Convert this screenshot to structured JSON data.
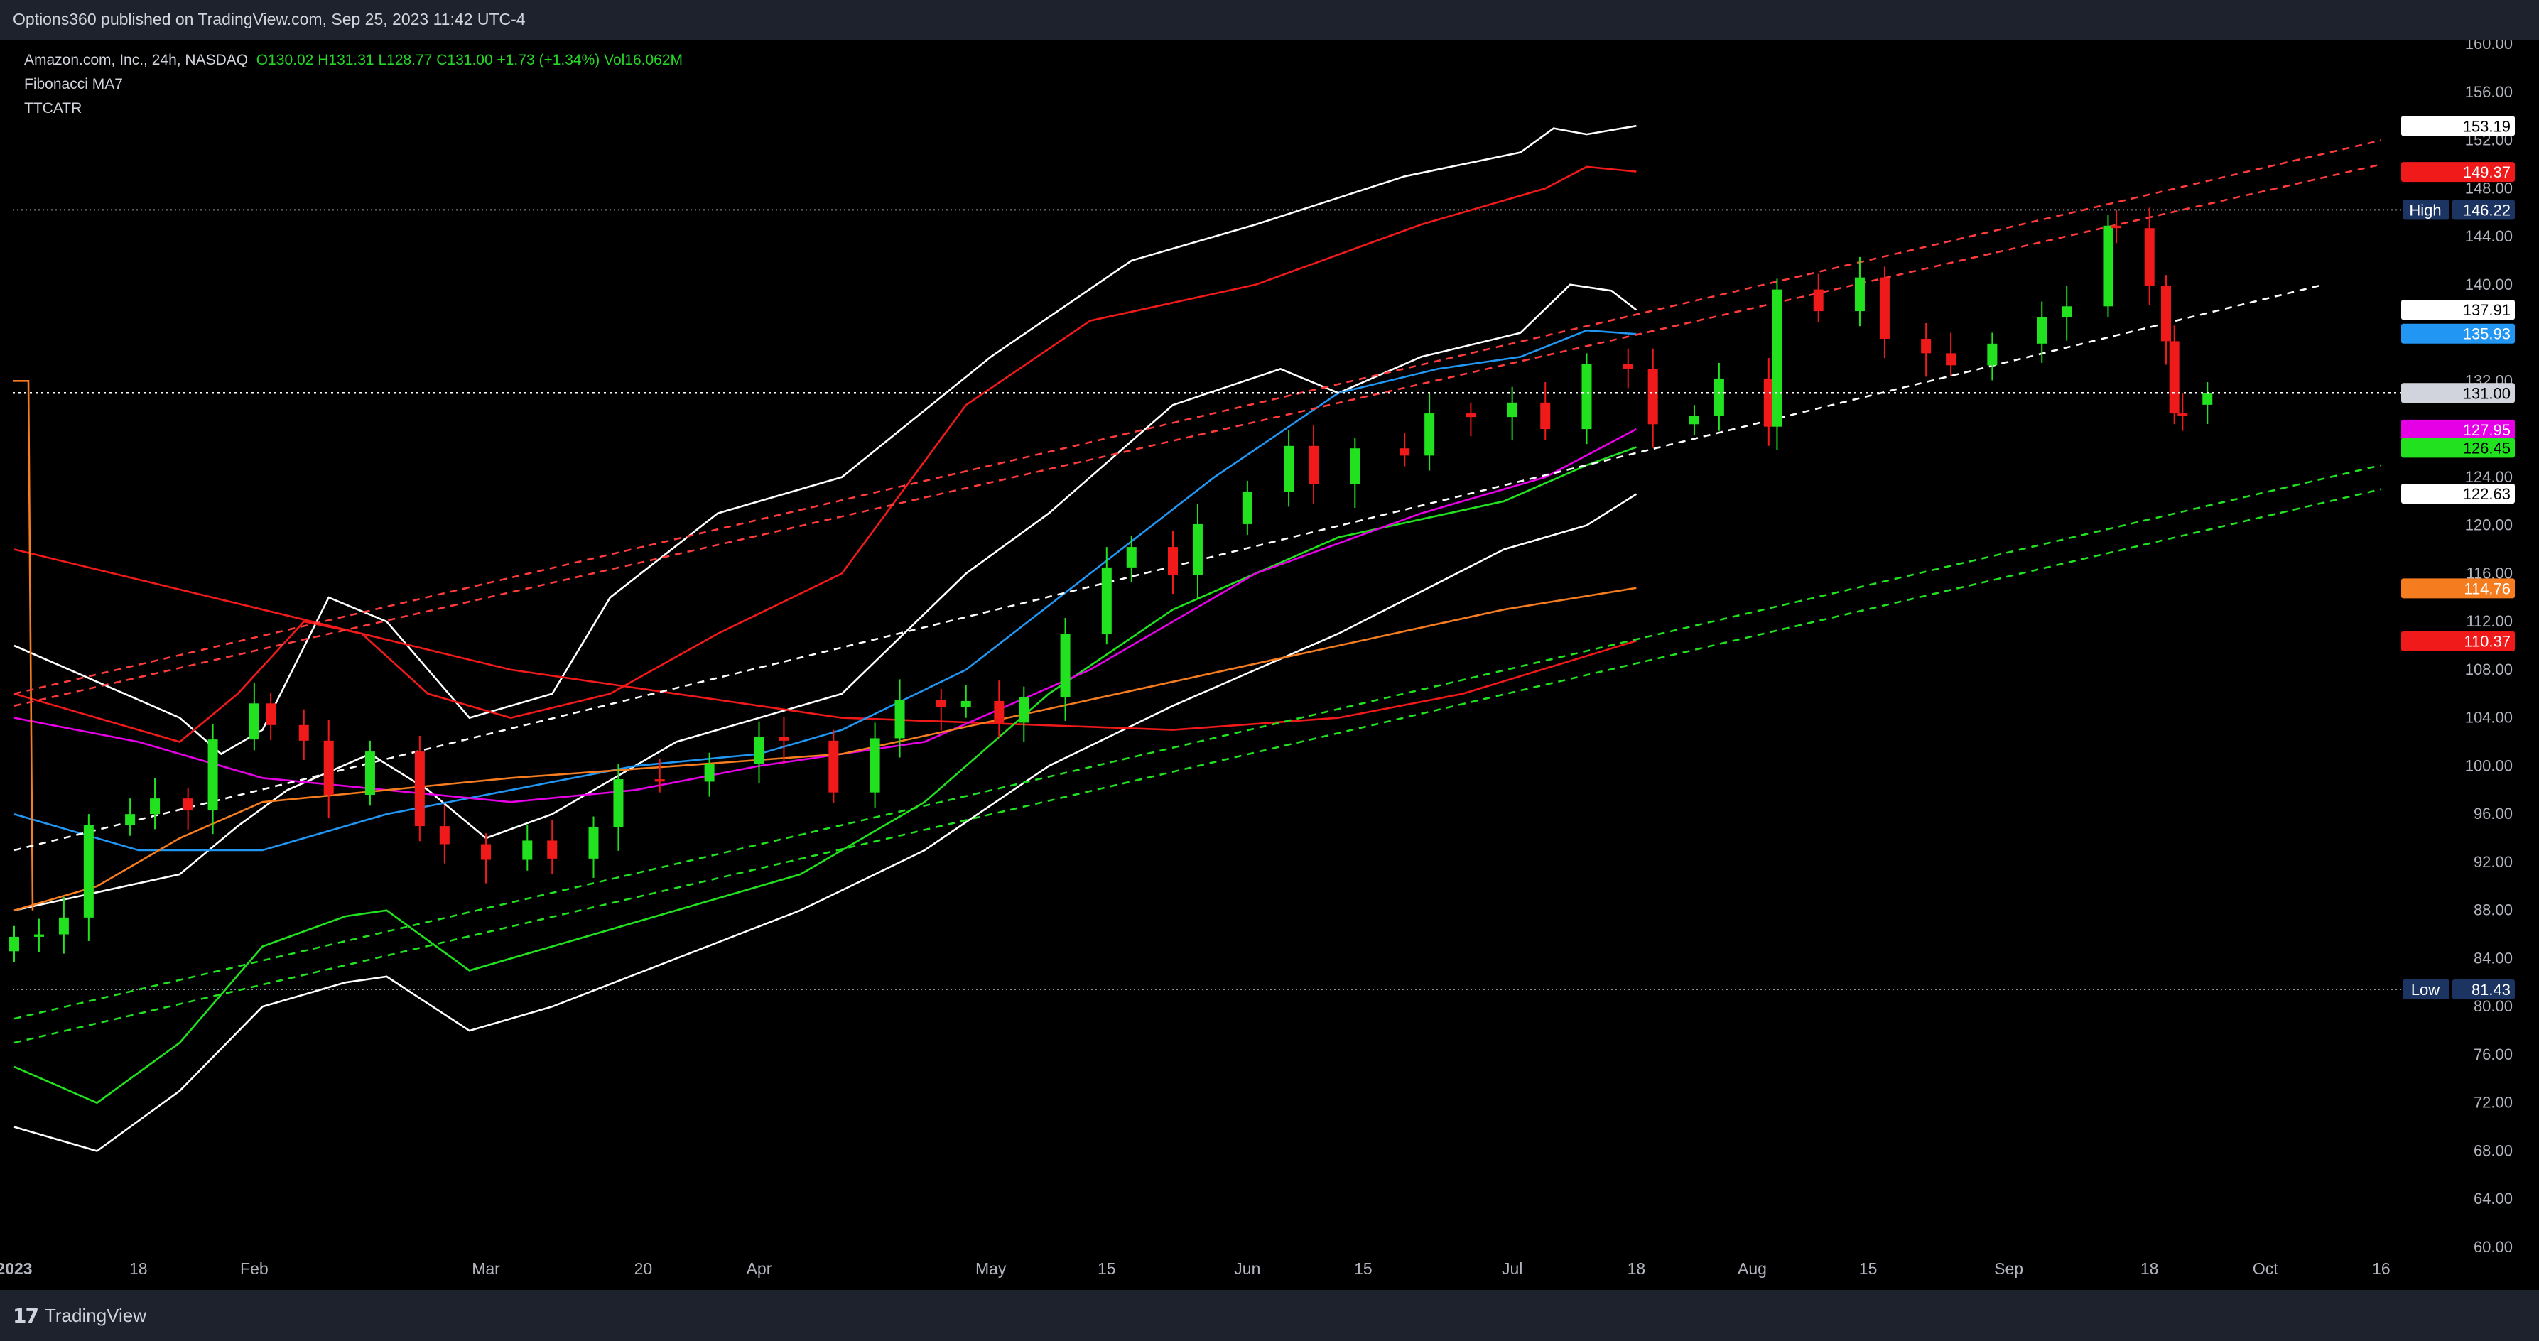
{
  "header": {
    "published": "Options360 published on TradingView.com, Sep 25, 2023 11:42 UTC-4"
  },
  "legend": {
    "symbol": "Amazon.com, Inc., 24h, NASDAQ",
    "open": "O130.02",
    "high": "H131.31",
    "low": "L128.77",
    "close": "C131.00",
    "change": "+1.73 (+1.34%)",
    "volume": "Vol16.062M",
    "indicator1": "Fibonacci MA7",
    "indicator2": "TTCATR"
  },
  "footer": {
    "brand": "TradingView"
  },
  "colors": {
    "up": "#22e11f",
    "down": "#f01a1a",
    "background": "#000000",
    "panel": "#1e222d"
  },
  "chart_data": {
    "type": "candlestick",
    "symbol": "AMZN",
    "ylim": [
      60,
      160
    ],
    "y_ticks": [
      "160.00",
      "156.00",
      "152.00",
      "148.00",
      "144.00",
      "140.00",
      "136.00",
      "132.00",
      "128.00",
      "124.00",
      "120.00",
      "116.00",
      "112.00",
      "108.00",
      "104.00",
      "100.00",
      "96.00",
      "92.00",
      "88.00",
      "84.00",
      "80.00",
      "76.00",
      "72.00",
      "68.00",
      "64.00",
      "60.00"
    ],
    "x_ticks": [
      {
        "label": "2023",
        "date": "2023-01-03"
      },
      {
        "label": "18",
        "date": "2023-01-18"
      },
      {
        "label": "Feb",
        "date": "2023-02-01"
      },
      {
        "label": "Mar",
        "date": "2023-03-01"
      },
      {
        "label": "20",
        "date": "2023-03-20"
      },
      {
        "label": "Apr",
        "date": "2023-04-03"
      },
      {
        "label": "May",
        "date": "2023-05-01"
      },
      {
        "label": "15",
        "date": "2023-05-15"
      },
      {
        "label": "Jun",
        "date": "2023-06-01"
      },
      {
        "label": "15",
        "date": "2023-06-15"
      },
      {
        "label": "Jul",
        "date": "2023-07-03"
      },
      {
        "label": "18",
        "date": "2023-07-18"
      },
      {
        "label": "Aug",
        "date": "2023-08-01"
      },
      {
        "label": "15",
        "date": "2023-08-15"
      },
      {
        "label": "Sep",
        "date": "2023-09-01"
      },
      {
        "label": "18",
        "date": "2023-09-18"
      },
      {
        "label": "Oct",
        "date": "2023-10-02"
      },
      {
        "label": "16",
        "date": "2023-10-16"
      }
    ],
    "closes": [
      {
        "date": "2023-01-03",
        "close": 85.8
      },
      {
        "date": "2023-01-06",
        "close": 86.0
      },
      {
        "date": "2023-01-09",
        "close": 87.4
      },
      {
        "date": "2023-01-12",
        "close": 95.1
      },
      {
        "date": "2023-01-17",
        "close": 96.0
      },
      {
        "date": "2023-01-20",
        "close": 97.3
      },
      {
        "date": "2023-01-24",
        "close": 96.3
      },
      {
        "date": "2023-01-27",
        "close": 102.2
      },
      {
        "date": "2023-02-01",
        "close": 105.2
      },
      {
        "date": "2023-02-03",
        "close": 103.4
      },
      {
        "date": "2023-02-07",
        "close": 102.1
      },
      {
        "date": "2023-02-10",
        "close": 97.6
      },
      {
        "date": "2023-02-15",
        "close": 101.2
      },
      {
        "date": "2023-02-21",
        "close": 95.0
      },
      {
        "date": "2023-02-24",
        "close": 93.5
      },
      {
        "date": "2023-03-01",
        "close": 92.2
      },
      {
        "date": "2023-03-06",
        "close": 93.8
      },
      {
        "date": "2023-03-09",
        "close": 92.3
      },
      {
        "date": "2023-03-14",
        "close": 94.9
      },
      {
        "date": "2023-03-17",
        "close": 98.9
      },
      {
        "date": "2023-03-22",
        "close": 98.7
      },
      {
        "date": "2023-03-28",
        "close": 100.2
      },
      {
        "date": "2023-04-03",
        "close": 102.4
      },
      {
        "date": "2023-04-06",
        "close": 102.1
      },
      {
        "date": "2023-04-12",
        "close": 97.8
      },
      {
        "date": "2023-04-17",
        "close": 102.3
      },
      {
        "date": "2023-04-20",
        "close": 105.5
      },
      {
        "date": "2023-04-25",
        "close": 104.9
      },
      {
        "date": "2023-04-28",
        "close": 105.4
      },
      {
        "date": "2023-05-02",
        "close": 103.6
      },
      {
        "date": "2023-05-05",
        "close": 105.7
      },
      {
        "date": "2023-05-10",
        "close": 111.0
      },
      {
        "date": "2023-05-15",
        "close": 116.5
      },
      {
        "date": "2023-05-18",
        "close": 118.2
      },
      {
        "date": "2023-05-23",
        "close": 115.9
      },
      {
        "date": "2023-05-26",
        "close": 120.1
      },
      {
        "date": "2023-06-01",
        "close": 122.8
      },
      {
        "date": "2023-06-06",
        "close": 126.6
      },
      {
        "date": "2023-06-09",
        "close": 123.4
      },
      {
        "date": "2023-06-14",
        "close": 126.4
      },
      {
        "date": "2023-06-20",
        "close": 125.8
      },
      {
        "date": "2023-06-23",
        "close": 129.3
      },
      {
        "date": "2023-06-28",
        "close": 129.0
      },
      {
        "date": "2023-07-03",
        "close": 130.2
      },
      {
        "date": "2023-07-07",
        "close": 128.0
      },
      {
        "date": "2023-07-12",
        "close": 133.4
      },
      {
        "date": "2023-07-17",
        "close": 133.0
      },
      {
        "date": "2023-07-20",
        "close": 128.4
      },
      {
        "date": "2023-07-25",
        "close": 129.1
      },
      {
        "date": "2023-07-28",
        "close": 132.2
      },
      {
        "date": "2023-08-03",
        "close": 128.2
      },
      {
        "date": "2023-08-04",
        "close": 139.6
      },
      {
        "date": "2023-08-09",
        "close": 137.8
      },
      {
        "date": "2023-08-14",
        "close": 140.6
      },
      {
        "date": "2023-08-17",
        "close": 135.5
      },
      {
        "date": "2023-08-22",
        "close": 134.3
      },
      {
        "date": "2023-08-25",
        "close": 133.3
      },
      {
        "date": "2023-08-30",
        "close": 135.1
      },
      {
        "date": "2023-09-05",
        "close": 137.3
      },
      {
        "date": "2023-09-08",
        "close": 138.2
      },
      {
        "date": "2023-09-13",
        "close": 144.9
      },
      {
        "date": "2023-09-14",
        "close": 144.7
      },
      {
        "date": "2023-09-18",
        "close": 139.9
      },
      {
        "date": "2023-09-20",
        "close": 135.3
      },
      {
        "date": "2023-09-21",
        "close": 129.3
      },
      {
        "date": "2023-09-22",
        "close": 129.1
      },
      {
        "date": "2023-09-25",
        "close": 131.0
      }
    ],
    "last_bar": {
      "open": 130.02,
      "high": 131.31,
      "low": 128.77,
      "close": 131.0
    },
    "high": {
      "label": "High",
      "value": 146.22
    },
    "low": {
      "label": "Low",
      "value": 81.43
    },
    "price_labels": [
      {
        "value": 153.19,
        "text": "153.19",
        "color": "#ffffff"
      },
      {
        "value": 149.37,
        "text": "149.37",
        "color": "#f01a1a"
      },
      {
        "value": 137.91,
        "text": "137.91",
        "color": "#ffffff"
      },
      {
        "value": 135.93,
        "text": "135.93",
        "color": "#2196f3"
      },
      {
        "value": 131.0,
        "text": "131.00",
        "color": "#d1d4dc"
      },
      {
        "value": 127.95,
        "text": "127.95",
        "color": "#e600e6"
      },
      {
        "value": 126.45,
        "text": "126.45",
        "color": "#22e11f"
      },
      {
        "value": 122.63,
        "text": "122.63",
        "color": "#ffffff"
      },
      {
        "value": 114.76,
        "text": "114.76",
        "color": "#f57c1f"
      },
      {
        "value": 110.37,
        "text": "110.37",
        "color": "#f01a1a"
      }
    ],
    "trendlines": [
      {
        "color": "#ffffff",
        "start": {
          "date": "2023-01-03",
          "price": 93
        },
        "end": {
          "date": "2023-10-09",
          "price": 140
        }
      },
      {
        "color": "#ff3b3b",
        "start": {
          "date": "2023-01-03",
          "price": 106
        },
        "end": {
          "date": "2023-10-16",
          "price": 152
        }
      },
      {
        "color": "#ff3b3b",
        "start": {
          "date": "2023-01-03",
          "price": 105
        },
        "end": {
          "date": "2023-10-16",
          "price": 150
        }
      },
      {
        "color": "#22e11f",
        "start": {
          "date": "2023-01-03",
          "price": 79
        },
        "end": {
          "date": "2023-10-16",
          "price": 125
        }
      },
      {
        "color": "#22e11f",
        "start": {
          "date": "2023-01-03",
          "price": 77
        },
        "end": {
          "date": "2023-10-16",
          "price": 123
        }
      }
    ],
    "indicators": [
      {
        "color": "#ffffff",
        "points": [
          [
            0,
            110
          ],
          [
            20,
            104
          ],
          [
            25,
            101
          ],
          [
            30,
            103
          ],
          [
            38,
            114
          ],
          [
            45,
            112
          ],
          [
            55,
            104
          ],
          [
            65,
            106
          ],
          [
            72,
            114
          ],
          [
            85,
            121
          ],
          [
            100,
            124
          ],
          [
            118,
            134
          ],
          [
            135,
            142
          ],
          [
            150,
            145
          ],
          [
            168,
            149
          ],
          [
            182,
            151
          ],
          [
            186,
            153
          ],
          [
            190,
            152.5
          ],
          [
            196,
            153.2
          ]
        ]
      },
      {
        "color": "#ffffff",
        "points": [
          [
            0,
            88
          ],
          [
            20,
            91
          ],
          [
            27,
            95
          ],
          [
            33,
            98
          ],
          [
            43,
            101
          ],
          [
            50,
            98
          ],
          [
            57,
            94
          ],
          [
            65,
            96
          ],
          [
            80,
            102
          ],
          [
            100,
            106
          ],
          [
            115,
            116
          ],
          [
            125,
            121
          ],
          [
            140,
            130
          ],
          [
            153,
            133
          ],
          [
            160,
            131
          ],
          [
            170,
            134
          ],
          [
            182,
            136
          ],
          [
            188,
            140
          ],
          [
            193,
            139.5
          ],
          [
            196,
            137.9
          ]
        ]
      },
      {
        "color": "#ffffff",
        "points": [
          [
            0,
            70
          ],
          [
            10,
            68
          ],
          [
            20,
            73
          ],
          [
            30,
            80
          ],
          [
            40,
            82
          ],
          [
            45,
            82.5
          ],
          [
            55,
            78
          ],
          [
            65,
            80
          ],
          [
            80,
            84
          ],
          [
            95,
            88
          ],
          [
            110,
            93
          ],
          [
            125,
            100
          ],
          [
            140,
            105
          ],
          [
            160,
            111
          ],
          [
            180,
            118
          ],
          [
            190,
            120
          ],
          [
            196,
            122.6
          ]
        ]
      },
      {
        "color": "#f01a1a",
        "points": [
          [
            0,
            106
          ],
          [
            20,
            102
          ],
          [
            27,
            106
          ],
          [
            35,
            112
          ],
          [
            42,
            111
          ],
          [
            50,
            106
          ],
          [
            60,
            104
          ],
          [
            72,
            106
          ],
          [
            85,
            111
          ],
          [
            100,
            116
          ],
          [
            115,
            130
          ],
          [
            130,
            137
          ],
          [
            150,
            140
          ],
          [
            170,
            145
          ],
          [
            185,
            148
          ],
          [
            190,
            149.8
          ],
          [
            196,
            149.4
          ]
        ]
      },
      {
        "color": "#f01a1a",
        "points": [
          [
            0,
            118
          ],
          [
            30,
            113
          ],
          [
            60,
            108
          ],
          [
            80,
            106
          ],
          [
            100,
            104
          ],
          [
            120,
            103.5
          ],
          [
            140,
            103
          ],
          [
            160,
            104
          ],
          [
            175,
            106
          ],
          [
            196,
            110.4
          ]
        ]
      },
      {
        "color": "#22e11f",
        "points": [
          [
            0,
            75
          ],
          [
            10,
            72
          ],
          [
            20,
            77
          ],
          [
            30,
            85
          ],
          [
            40,
            87.5
          ],
          [
            45,
            88
          ],
          [
            55,
            83
          ],
          [
            65,
            85
          ],
          [
            80,
            88
          ],
          [
            95,
            91
          ],
          [
            110,
            97
          ],
          [
            125,
            106
          ],
          [
            140,
            113
          ],
          [
            160,
            119
          ],
          [
            180,
            122
          ],
          [
            190,
            125
          ],
          [
            196,
            126.5
          ]
        ]
      },
      {
        "color": "#2196f3",
        "points": [
          [
            0,
            96
          ],
          [
            15,
            93
          ],
          [
            30,
            93
          ],
          [
            45,
            96
          ],
          [
            60,
            98
          ],
          [
            75,
            100
          ],
          [
            90,
            101
          ],
          [
            100,
            103
          ],
          [
            115,
            108
          ],
          [
            130,
            116
          ],
          [
            145,
            124
          ],
          [
            160,
            131
          ],
          [
            172,
            133
          ],
          [
            182,
            134
          ],
          [
            190,
            136.2
          ],
          [
            196,
            135.9
          ]
        ]
      },
      {
        "color": "#e600e6",
        "points": [
          [
            0,
            104
          ],
          [
            15,
            102
          ],
          [
            30,
            99
          ],
          [
            45,
            98
          ],
          [
            60,
            97
          ],
          [
            75,
            98
          ],
          [
            90,
            100
          ],
          [
            110,
            102
          ],
          [
            130,
            108
          ],
          [
            150,
            116
          ],
          [
            170,
            121
          ],
          [
            185,
            124
          ],
          [
            196,
            128
          ]
        ]
      },
      {
        "color": "#f57c1f",
        "points": [
          [
            0,
            88
          ],
          [
            10,
            90
          ],
          [
            20,
            94
          ],
          [
            30,
            97
          ],
          [
            45,
            98
          ],
          [
            60,
            99
          ],
          [
            80,
            100
          ],
          [
            100,
            101
          ],
          [
            120,
            104
          ],
          [
            140,
            107
          ],
          [
            160,
            110
          ],
          [
            180,
            113
          ],
          [
            196,
            114.8
          ]
        ]
      }
    ],
    "grid": false,
    "legend_placement": "top-left"
  }
}
